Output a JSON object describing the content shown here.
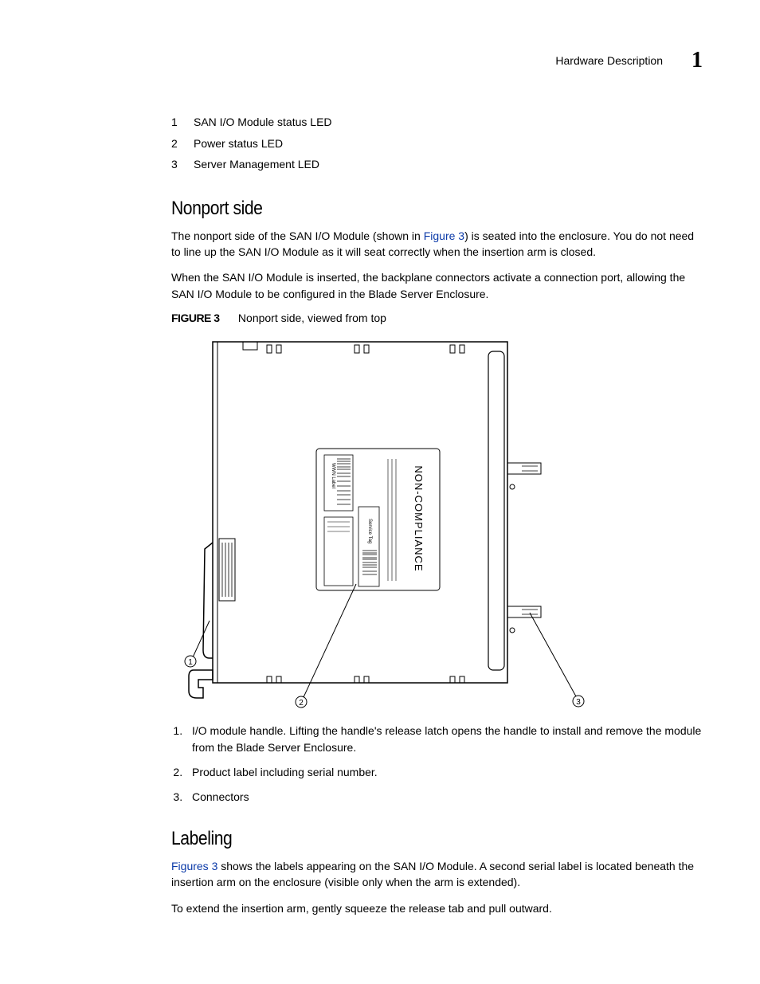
{
  "header": {
    "title": "Hardware Description",
    "chapter_number": "1"
  },
  "top_list": [
    {
      "num": "1",
      "text": "SAN I/O Module status LED"
    },
    {
      "num": "2",
      "text": "Power status LED"
    },
    {
      "num": "3",
      "text": "Server Management LED"
    }
  ],
  "section1": {
    "heading": "Nonport side",
    "para1_pre": "The nonport side of the SAN I/O Module (shown in ",
    "para1_link": "Figure 3",
    "para1_post": ") is seated into the enclosure. You do not need to line up the SAN I/O Module as it will seat correctly when the insertion arm is closed.",
    "para2": "When the SAN I/O Module is inserted, the backplane connectors activate a connection port, allowing the SAN I/O Module to be configured in the Blade Server Enclosure.",
    "figure_label": "FIGURE 3",
    "figure_caption": "Nonport side, viewed from top"
  },
  "figure_labels": {
    "noncompliance": "NON-COMPLIANCE",
    "service_tag": "Service Tag",
    "wwn_label": "WWN Label",
    "callout1": "1",
    "callout2": "2",
    "callout3": "3"
  },
  "callouts": [
    "I/O module handle. Lifting the handle's release latch opens the handle to install and remove the module from the Blade Server Enclosure.",
    "Product label including serial number.",
    "Connectors"
  ],
  "section2": {
    "heading": "Labeling",
    "para1_link": "Figures 3",
    "para1_post": " shows the labels appearing on the SAN I/O Module. A second serial label is located beneath the insertion arm on the enclosure (visible only when the arm is extended).",
    "para2": "To extend the insertion arm, gently squeeze the release tab and pull outward."
  }
}
